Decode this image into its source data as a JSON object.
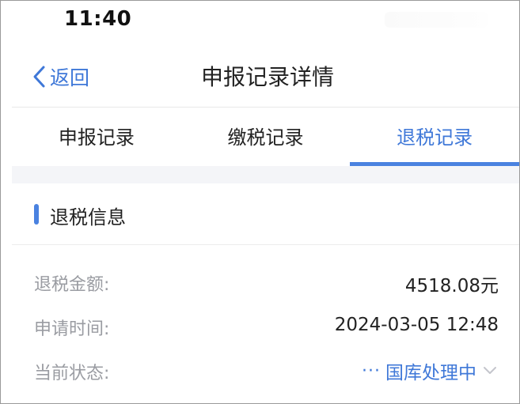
{
  "status_bar": {
    "time": "11:40"
  },
  "nav": {
    "back_label": "返回",
    "title": "申报记录详情"
  },
  "tabs": [
    {
      "label": "申报记录",
      "active": false
    },
    {
      "label": "缴税记录",
      "active": false
    },
    {
      "label": "退税记录",
      "active": true
    }
  ],
  "section": {
    "title": "退税信息",
    "rows": [
      {
        "label": "退税金额:",
        "value": "4518.08元"
      },
      {
        "label": "申请时间:",
        "value": "2024-03-05 12:48"
      },
      {
        "label": "当前状态:",
        "value": "国库处理中",
        "prefix": "···"
      }
    ]
  },
  "colors": {
    "accent": "#4a82e0",
    "link": "#3f78d8",
    "label_gray": "#9a9ca2",
    "gap_bg": "#f4f5f8"
  },
  "icons": {
    "back": "chevron-left-icon",
    "status": "chevron-down-icon"
  }
}
